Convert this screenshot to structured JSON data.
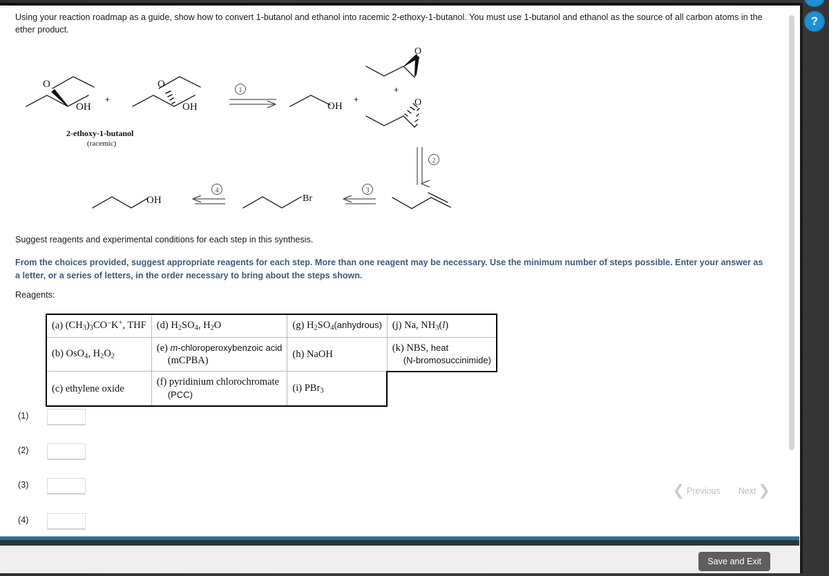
{
  "question": {
    "prompt": "Using your reaction roadmap as a guide, show how to convert 1-butanol and ethanol into racemic 2-ethoxy-1-butanol. You must use 1-butanol and ethanol as the source of all carbon atoms in the ether product."
  },
  "scheme": {
    "product_name_line1": "2-ethoxy-1-butanol",
    "product_name_line2": "(racemic)",
    "step_labels": [
      "1",
      "2",
      "3",
      "4"
    ],
    "plus_signs": [
      "+",
      "+",
      "+"
    ],
    "atom_labels": {
      "oh": "OH",
      "o": "O",
      "br": "Br"
    },
    "structures": [
      {
        "name": "(R)-2-ethoxy-1-butanol",
        "label": "OH"
      },
      {
        "name": "(S)-2-ethoxy-1-butanol",
        "label": "OH"
      },
      {
        "name": "ethanol",
        "label": "OH"
      },
      {
        "name": "(R)-1,2-epoxybutane",
        "label": "O"
      },
      {
        "name": "(S)-1,2-epoxybutane",
        "label": "O"
      },
      {
        "name": "1-butene",
        "label": ""
      },
      {
        "name": "1-bromobutane",
        "label": "Br"
      },
      {
        "name": "1-butanol",
        "label": "OH"
      }
    ]
  },
  "instructions": {
    "line1": "Suggest reagents and experimental conditions for each step in this synthesis.",
    "line2": "From the choices provided, suggest appropriate reagents for each step. More than one reagent may be necessary. Use the minimum number of steps possible. Enter your answer as a letter, or a series of letters, in the order necessary to bring about the steps shown.",
    "reagents_label": "Reagents:"
  },
  "reagents": {
    "col1": [
      {
        "key": "(a)",
        "html": "(CH<sub>3</sub>)<sub>3</sub>CO<sup>&#8722;</sup>K<sup>+</sup>, THF",
        "plain": "(a) (CH3)3CO- K+, THF"
      },
      {
        "key": "(b)",
        "html": "OsO<sub>4</sub>, H<sub>2</sub>O<sub>2</sub>",
        "plain": "(b) OsO4, H2O2"
      },
      {
        "key": "(c)",
        "html": "ethylene oxide",
        "plain": "(c) ethylene oxide"
      }
    ],
    "col2": [
      {
        "key": "(d)",
        "html": "H<sub>2</sub>SO<sub>4</sub>, H<sub>2</sub>O",
        "plain": "(d) H2SO4, H2O"
      },
      {
        "key": "(e)",
        "html": "<span class=\"sans\"><span class=\"ital\">m</span>-chloroperoxybenzoic acid</span><br><span class=\"indent2\">(mCPBA)</span>",
        "plain": "(e) m-chloroperoxybenzoic acid (mCPBA)"
      },
      {
        "key": "(f)",
        "html": "pyridinium chlorochromate<br><span class=\"indent2 sans\">(PCC)</span>",
        "plain": "(f) pyridinium chlorochromate (PCC)"
      }
    ],
    "col3": [
      {
        "key": "(g)",
        "html": "H<sub>2</sub>SO<sub>4</sub><span class=\"sans\">(anhydrous)</span>",
        "plain": "(g) H2SO4 (anhydrous)"
      },
      {
        "key": "(h)",
        "html": "NaOH",
        "plain": "(h) NaOH"
      },
      {
        "key": "(i)",
        "html": "PBr<sub>3</sub>",
        "plain": "(i) PBr3"
      }
    ],
    "col4": [
      {
        "key": "(j)",
        "html": "Na, NH<sub>3</sub>(<span class=\"ital\">l</span>)",
        "plain": "(j) Na, NH3 (l)"
      },
      {
        "key": "(k)",
        "html": "NBS, <span class=\"sans\">heat</span><br><span class=\"indent2 sans\">(N-bromosuccinimide)</span>",
        "plain": "(k) NBS, heat (N-bromosuccinimide)"
      },
      {
        "key": "",
        "html": "",
        "plain": ""
      }
    ]
  },
  "answers": [
    {
      "label": "(1)",
      "value": "",
      "placeholder": ""
    },
    {
      "label": "(2)",
      "value": "",
      "placeholder": ""
    },
    {
      "label": "(3)",
      "value": "",
      "placeholder": ""
    },
    {
      "label": "(4)",
      "value": "",
      "placeholder": ""
    }
  ],
  "nav": {
    "previous": "Previous",
    "next": "Next",
    "prev_chevron": "❮",
    "next_chevron": "❯"
  },
  "footer": {
    "save_exit": "Save and Exit"
  },
  "side_icons": {
    "help": "?"
  },
  "colors": {
    "accent_blue": "#2e6f9a",
    "instruction_blue": "#3d5a80",
    "help_icon_blue": "#1c91d4",
    "save_button_gray": "#5e5e5e"
  }
}
